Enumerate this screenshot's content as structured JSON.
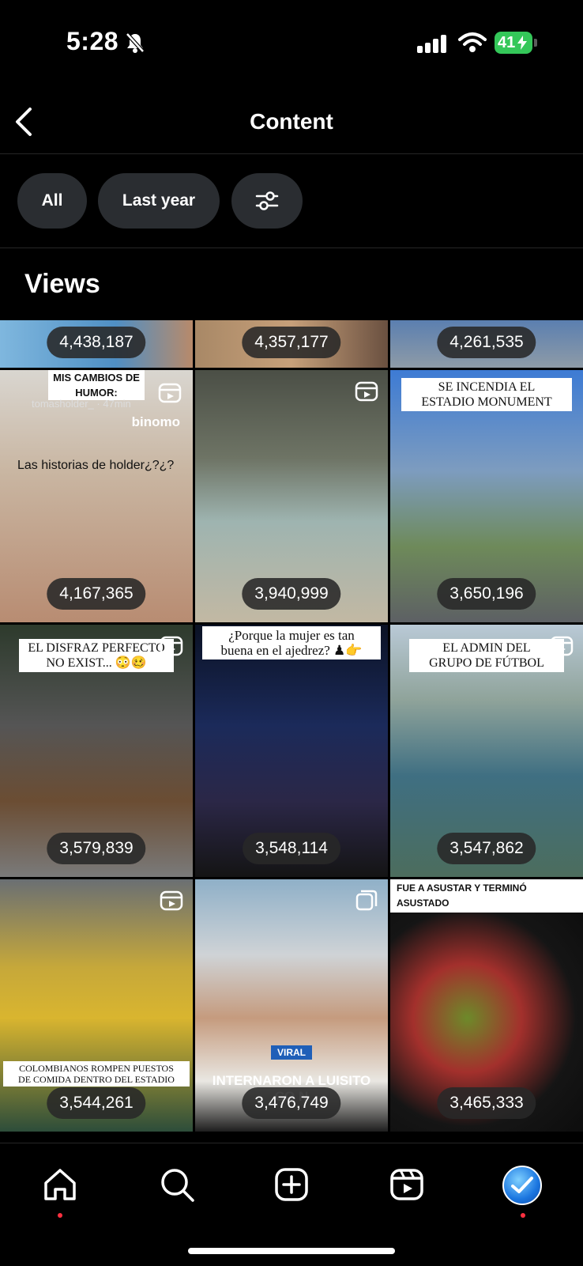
{
  "status": {
    "time": "5:28",
    "battery": "41"
  },
  "header": {
    "title": "Content"
  },
  "filters": {
    "all": "All",
    "period": "Last year"
  },
  "section": {
    "title": "Views"
  },
  "tiles": [
    {
      "views": "4,438,187"
    },
    {
      "views": "4,357,177"
    },
    {
      "views": "4,261,535"
    },
    {
      "views": "4,167,365",
      "caption": "tomasholder_ · 47min",
      "overlay": "Las historias de holder¿?¿?",
      "brand": "binomo",
      "heading": "MIS CAMBIOS DE HUMOR:"
    },
    {
      "views": "3,940,999"
    },
    {
      "views": "3,650,196",
      "overlay": "SE INCENDIA EL\nESTADIO MONUMENT"
    },
    {
      "views": "3,579,839",
      "overlay": "EL DISFRAZ PERFECTO\nNO EXIST... 😳🥴"
    },
    {
      "views": "3,548,114",
      "overlay": "¿Porque la mujer es tan\nbuena en el ajedrez? ♟👉"
    },
    {
      "views": "3,547,862",
      "overlay": "EL ADMIN DEL\nGRUPO DE FÚTBOL"
    },
    {
      "views": "3,544,261",
      "overlay": "COLOMBIANOS ROMPEN PUESTOS\nDE COMIDA DENTRO DEL ESTADIO"
    },
    {
      "views": "3,476,749",
      "badge": "VIRAL",
      "overlay": "INTERNARON A LUISITO\nCO N"
    },
    {
      "views": "3,465,333",
      "overlay": "FUE A ASUSTAR Y TERMINÓ ASUSTADO"
    }
  ]
}
